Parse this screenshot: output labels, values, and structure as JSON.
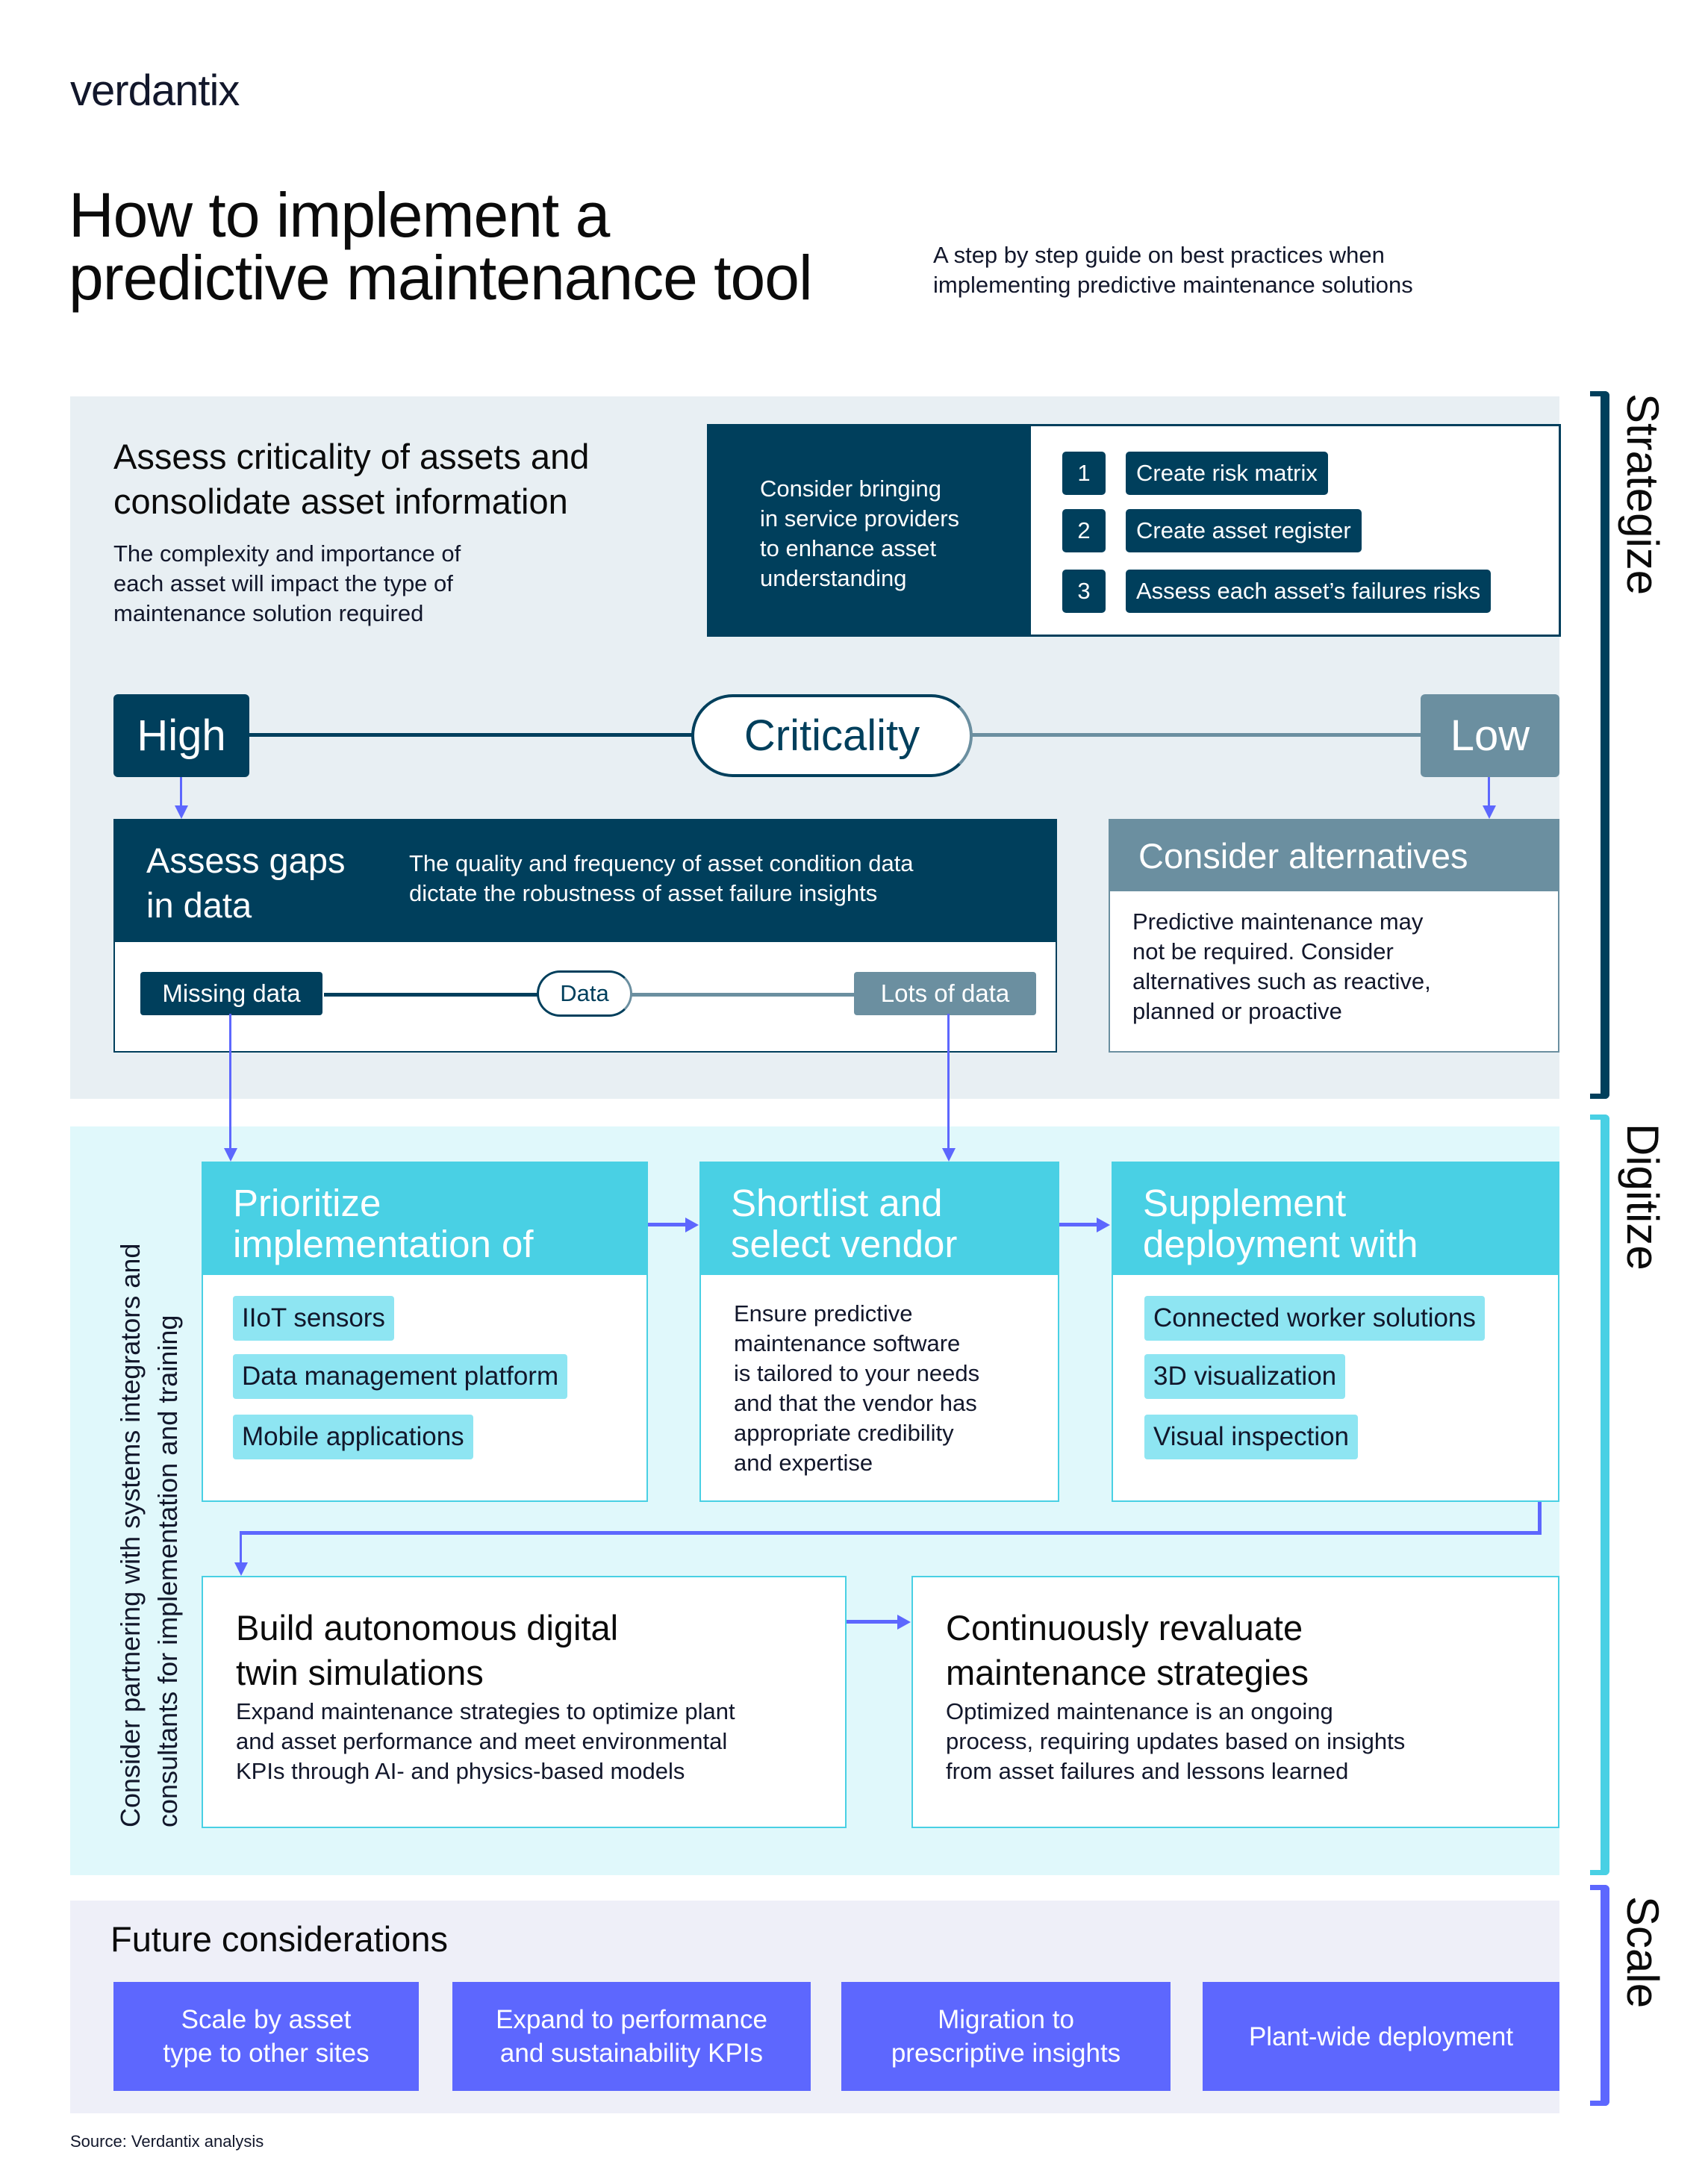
{
  "logo": "verdantix",
  "header": {
    "title_line1": "How to implement a",
    "title_line2": "predictive maintenance tool",
    "subtitle_line1": "A step by step guide on best practices when",
    "subtitle_line2": "implementing predictive maintenance solutions"
  },
  "phases": {
    "strategize": "Strategize",
    "digitize": "Digitize",
    "scale": "Scale"
  },
  "colors": {
    "strategize": "#003f5c",
    "digitize": "#49d0e4",
    "scale": "#5d67fe",
    "low": "#6b8fa0"
  },
  "strategize": {
    "heading_line1": "Assess criticality of assets and",
    "heading_line2": "consolidate asset information",
    "description_line1": "The complexity and importance of",
    "description_line2": "each asset will impact the type of",
    "description_line3": "maintenance solution required",
    "service_box": {
      "text_line1": "Consider bringing",
      "text_line2": "in service providers",
      "text_line3": "to enhance asset",
      "text_line4": "understanding",
      "steps": [
        {
          "number": "1",
          "label": "Create risk matrix"
        },
        {
          "number": "2",
          "label": "Create asset register"
        },
        {
          "number": "3",
          "label": "Assess each asset’s failures risks"
        }
      ]
    },
    "criticality": {
      "high": "High",
      "center": "Criticality",
      "low": "Low"
    },
    "gaps": {
      "title_line1": "Assess gaps",
      "title_line2": "in data",
      "desc_line1": "The quality and frequency of asset condition data",
      "desc_line2": "dictate the robustness of asset failure insights",
      "missing": "Missing data",
      "center": "Data",
      "lots": "Lots of data"
    },
    "alternatives": {
      "title": "Consider alternatives",
      "body_line1": "Predictive maintenance may",
      "body_line2": "not be required. Consider",
      "body_line3": "alternatives such as reactive,",
      "body_line4": "planned or proactive"
    }
  },
  "digitize": {
    "side_note_line1": "Consider partnering with systems integrators and",
    "side_note_line2": "consultants for implementation and training",
    "prioritize": {
      "title_line1": "Prioritize",
      "title_line2": "implementation of",
      "items": [
        "IIoT sensors",
        "Data management platform",
        "Mobile applications"
      ]
    },
    "shortlist": {
      "title_line1": "Shortlist and",
      "title_line2": "select vendor",
      "body": [
        "Ensure predictive",
        "maintenance software",
        "is tailored to your needs",
        "and that the vendor has",
        "appropriate credibility",
        "and expertise"
      ]
    },
    "supplement": {
      "title_line1": "Supplement",
      "title_line2": "deployment with",
      "items": [
        "Connected worker solutions",
        "3D visualization",
        "Visual inspection"
      ]
    },
    "digital_twin": {
      "title_line1": "Build autonomous digital",
      "title_line2": "twin simulations",
      "body": [
        "Expand maintenance strategies to optimize plant",
        "and asset performance and meet environmental",
        "KPIs through AI- and physics-based models"
      ]
    },
    "revaluate": {
      "title_line1": "Continuously revaluate",
      "title_line2": "maintenance strategies",
      "body": [
        "Optimized maintenance is an ongoing",
        "process, requiring updates based on insights",
        "from asset failures and lessons learned"
      ]
    }
  },
  "scale": {
    "title": "Future considerations",
    "items": [
      {
        "line1": "Scale by asset",
        "line2": "type to other sites"
      },
      {
        "line1": "Expand to performance",
        "line2": "and sustainability KPIs"
      },
      {
        "line1": "Migration to",
        "line2": "prescriptive insights"
      },
      {
        "line1": "Plant-wide deployment",
        "line2": ""
      }
    ]
  },
  "source": "Source: Verdantix analysis"
}
